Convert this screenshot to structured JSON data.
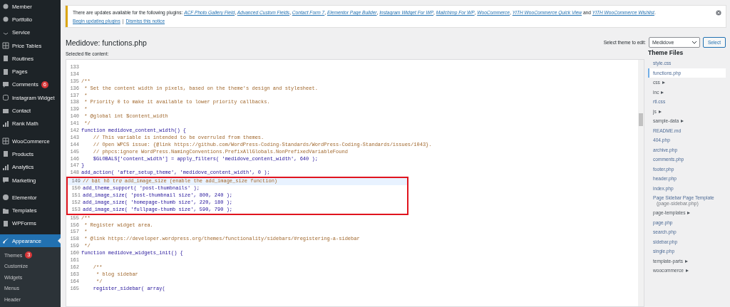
{
  "sidebar": {
    "items": [
      {
        "label": "Member",
        "selected": false
      },
      {
        "label": "Portfolio",
        "selected": false
      },
      {
        "label": "Service",
        "selected": false
      },
      {
        "label": "Price Tables",
        "selected": false
      },
      {
        "label": "Routines",
        "selected": false
      },
      {
        "label": "Pages",
        "selected": false
      },
      {
        "label": "Comments",
        "selected": false,
        "badge": "6"
      },
      {
        "label": "Instagram Widget",
        "selected": false
      },
      {
        "label": "Contact",
        "selected": false
      },
      {
        "label": "Rank Math",
        "selected": false
      },
      {
        "label": "WooCommerce",
        "selected": false
      },
      {
        "label": "Products",
        "selected": false
      },
      {
        "label": "Analytics",
        "selected": false
      },
      {
        "label": "Marketing",
        "selected": false
      },
      {
        "label": "Elementor",
        "selected": false
      },
      {
        "label": "Templates",
        "selected": false
      },
      {
        "label": "WPForms",
        "selected": false
      },
      {
        "label": "Appearance",
        "selected": true
      }
    ],
    "submenu": [
      {
        "label": "Themes",
        "badge": "3"
      },
      {
        "label": "Customize"
      },
      {
        "label": "Widgets"
      },
      {
        "label": "Menus"
      },
      {
        "label": "Header"
      }
    ]
  },
  "notice": {
    "parts": [
      {
        "text": "There are updates available for the following plugins: ",
        "link": false
      },
      {
        "text": "ACF Photo Gallery Field",
        "link": true
      },
      {
        "text": ", ",
        "link": false
      },
      {
        "text": "Advanced Custom Fields",
        "link": true
      },
      {
        "text": ", ",
        "link": false
      },
      {
        "text": "Contact Form 7",
        "link": true
      },
      {
        "text": ", ",
        "link": false
      },
      {
        "text": "Elementor Page Builder",
        "link": true
      },
      {
        "text": ", ",
        "link": false
      },
      {
        "text": "Instagram Widget For WP",
        "link": true
      },
      {
        "text": ", ",
        "link": false
      },
      {
        "text": "Mailchimp For WP",
        "link": true
      },
      {
        "text": ", ",
        "link": false
      },
      {
        "text": "WooCommerce",
        "link": true
      },
      {
        "text": ", ",
        "link": false
      },
      {
        "text": "YITH WooCommerce Quick View",
        "link": true
      },
      {
        "text": " and ",
        "link": false
      },
      {
        "text": "YITH WooCommerce Wishlist",
        "link": true
      },
      {
        "text": ".",
        "link": false
      }
    ],
    "actions": [
      "Begin updating plugins",
      "Dismiss this notice"
    ],
    "separator": "|"
  },
  "page_title": "Medidove: functions.php",
  "theme_select": {
    "label": "Select theme to edit:",
    "value": "Medidove",
    "button": "Select"
  },
  "selected_label": "Selected file content:",
  "code": {
    "lines": [
      {
        "number": "133",
        "marked": false,
        "active": false
      },
      {
        "number": "134",
        "marked": false,
        "active": false
      },
      {
        "number": "135",
        "text": "/**",
        "kind": "comment",
        "marked": false,
        "active": false
      },
      {
        "number": "136",
        "text": " * Set the content width in pixels, based on the theme's design and stylesheet.",
        "kind": "comment",
        "marked": false,
        "active": false
      },
      {
        "number": "137",
        "text": " *",
        "kind": "comment",
        "marked": false,
        "active": false
      },
      {
        "number": "138",
        "text": " * Priority 0 to make it available to lower priority callbacks.",
        "kind": "comment",
        "marked": false,
        "active": false
      },
      {
        "number": "139",
        "text": " *",
        "kind": "comment",
        "marked": false,
        "active": false
      },
      {
        "number": "140",
        "text": " * @global int $content_width",
        "kind": "comment",
        "marked": false,
        "active": false
      },
      {
        "number": "141",
        "text": " */",
        "kind": "comment",
        "marked": false,
        "active": false
      },
      {
        "number": "142",
        "text": "function medidove_content_width() {",
        "kind": "code",
        "marked": false,
        "active": false
      },
      {
        "number": "143",
        "text": "    // This variable is intended to be overruled from themes.",
        "kind": "comment",
        "marked": false,
        "active": false
      },
      {
        "number": "144",
        "text": "    // Open WPCS issue: {@link https://github.com/WordPress-Coding-Standards/WordPress-Coding-Standards/issues/1043}.",
        "kind": "comment",
        "marked": false,
        "active": false
      },
      {
        "number": "145",
        "text": "    // phpcs:ignore WordPress.NamingConventions.PrefixAllGlobals.NonPrefixedVariableFound",
        "kind": "comment",
        "marked": false,
        "active": false
      },
      {
        "number": "146",
        "text": "    $GLOBALS['content_width'] = apply_filters( 'medidove_content_width', 640 );",
        "kind": "code",
        "marked": false,
        "active": false
      },
      {
        "number": "147",
        "text": "}",
        "kind": "code",
        "marked": false,
        "active": false
      },
      {
        "number": "148",
        "text": "add_action( 'after_setup_theme', 'medidove_content_width', 0 );",
        "kind": "code",
        "marked": false,
        "active": false
      },
      {
        "number": "149",
        "text": "// bật hỗ trợ add_image_size (enable the add_image_size function)",
        "kind": "comment",
        "marked": true,
        "active": true
      },
      {
        "number": "150",
        "text": "add_theme_support( 'post-thumbnails' );",
        "kind": "code",
        "marked": true,
        "active": false
      },
      {
        "number": "151",
        "text": "add_image_size( 'post-thumbnail size', 800, 240 );",
        "kind": "code",
        "marked": true,
        "active": false
      },
      {
        "number": "152",
        "text": "add_image_size( 'homepage-thumb size', 220, 180 );",
        "kind": "code",
        "marked": true,
        "active": false
      },
      {
        "number": "153",
        "text": "add_image_size( 'fullpage-thumb size', 590, 790 );",
        "kind": "code",
        "marked": true,
        "active": false
      },
      {
        "number": "155",
        "text": "/**",
        "kind": "comment",
        "marked": false,
        "active": false
      },
      {
        "number": "156",
        "text": " * Register widget area.",
        "kind": "comment",
        "marked": false,
        "active": false
      },
      {
        "number": "157",
        "text": " *",
        "kind": "comment",
        "marked": false,
        "active": false
      },
      {
        "number": "158",
        "text": " * @link https://developer.wordpress.org/themes/functionality/sidebars/#registering-a-sidebar",
        "kind": "comment",
        "marked": false,
        "active": false
      },
      {
        "number": "159",
        "text": " */",
        "kind": "comment",
        "marked": false,
        "active": false
      },
      {
        "number": "160",
        "text": "function medidove_widgets_init() {",
        "kind": "code",
        "marked": false,
        "active": false
      },
      {
        "number": "161",
        "marked": false,
        "active": false
      },
      {
        "number": "162",
        "text": "    /**",
        "kind": "comment",
        "marked": false,
        "active": false
      },
      {
        "number": "163",
        "text": "     * blog sidebar",
        "kind": "comment",
        "marked": false,
        "active": false
      },
      {
        "number": "164",
        "text": "     */",
        "kind": "comment",
        "marked": false,
        "active": false
      },
      {
        "number": "165",
        "text": "    register_sidebar( array(",
        "kind": "code",
        "marked": false,
        "active": false
      }
    ]
  },
  "theme_files": {
    "title": "Theme Files",
    "items": [
      {
        "label": "style.css",
        "kind": "file",
        "selected": false
      },
      {
        "label": "functions.php",
        "kind": "file",
        "selected": true
      },
      {
        "label": "css",
        "kind": "folder",
        "selected": false
      },
      {
        "label": "inc",
        "kind": "folder",
        "selected": false
      },
      {
        "label": "rtl.css",
        "kind": "file",
        "selected": false
      },
      {
        "label": "js",
        "kind": "folder",
        "selected": false
      },
      {
        "label": "sample-data",
        "kind": "folder",
        "selected": false
      },
      {
        "label": "README.md",
        "kind": "file",
        "selected": false
      },
      {
        "label": "404.php",
        "kind": "file",
        "selected": false
      },
      {
        "label": "archive.php",
        "kind": "file",
        "selected": false
      },
      {
        "label": "comments.php",
        "kind": "file",
        "selected": false
      },
      {
        "label": "footer.php",
        "kind": "file",
        "selected": false
      },
      {
        "label": "header.php",
        "kind": "file",
        "selected": false
      },
      {
        "label": "index.php",
        "kind": "file",
        "selected": false
      },
      {
        "label": "Page Sidebar Page Template",
        "note": "(page-sidebar.php)",
        "kind": "file",
        "selected": false
      },
      {
        "label": "page-templates",
        "kind": "folder",
        "selected": false
      },
      {
        "label": "page.php",
        "kind": "file",
        "selected": false
      },
      {
        "label": "search.php",
        "kind": "file",
        "selected": false
      },
      {
        "label": "sidebar.php",
        "kind": "file",
        "selected": false
      },
      {
        "label": "single.php",
        "kind": "file",
        "selected": false
      },
      {
        "label": "template-parts",
        "kind": "folder",
        "selected": false
      },
      {
        "label": "woocommerce",
        "kind": "folder",
        "selected": false
      }
    ]
  }
}
